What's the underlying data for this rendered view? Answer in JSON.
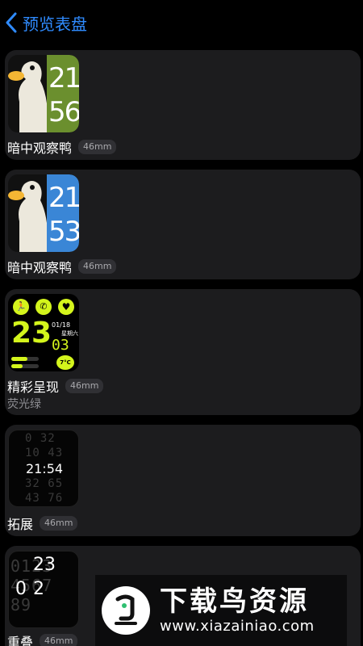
{
  "header": {
    "title": "预览表盘",
    "back_icon": "chevron-left-icon"
  },
  "colors": {
    "accent": "#2f8bff",
    "card_bg": "#1c1c1e",
    "duck_green": "#6b8f2e",
    "duck_blue": "#3a86d6",
    "neon": "#d4f51c"
  },
  "faces": [
    {
      "name": "暗中观察鸭",
      "size": "46mm",
      "hour": "21",
      "minute": "56",
      "band_color": "#6b8f2e"
    },
    {
      "name": "暗中观察鸭",
      "size": "46mm",
      "hour": "21",
      "minute": "53",
      "band_color": "#3a86d6"
    },
    {
      "name": "精彩呈现",
      "size": "46mm",
      "subtitle": "荧光绿",
      "hour": "23",
      "minute": "03",
      "date": "01/18",
      "weekday": "星期六",
      "temp": "7°C"
    },
    {
      "name": "拓展",
      "size": "46mm",
      "time": "21:54"
    },
    {
      "name": "重叠",
      "size": "46mm",
      "hour": "23",
      "minute": "02"
    }
  ],
  "watermark": {
    "title": "下载鸟资源",
    "url": "www.xiazainiao.com"
  }
}
